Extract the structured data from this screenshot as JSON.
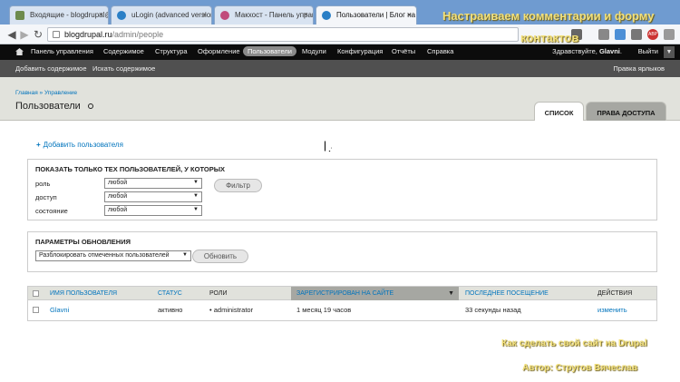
{
  "browser": {
    "tabs": [
      {
        "title": "Входящие - blogdrupal@",
        "color": "#6d8b4d"
      },
      {
        "title": "uLogin (advanced version",
        "color": "#2a7fc6"
      },
      {
        "title": "Макхост - Панель управ",
        "color": "#c04b7c"
      },
      {
        "title": "Пользователи | Блог на",
        "color": "#2a7fc6"
      }
    ],
    "tab_close": "×",
    "back_icon": "◀",
    "forward_icon": "▶",
    "reload_icon": "↻",
    "url_host": "blogdrupal.ru",
    "url_path": "/admin/people",
    "overlay_title_line1": "Настраиваем комментарии и форму",
    "overlay_title_line2": "контактов",
    "ext_label": "ABP"
  },
  "admin_toolbar": {
    "items": [
      "Панель управления",
      "Содержимое",
      "Структура",
      "Оформление",
      "Пользователи",
      "Модули",
      "Конфигурация",
      "Отчёты",
      "Справка"
    ],
    "active": "Пользователи",
    "greeting_prefix": "Здравствуйте,",
    "username": "Glavni",
    "greeting_suffix": ".",
    "logout": "Выйти",
    "toggle": "▼"
  },
  "shortcuts": {
    "items": [
      "Добавить содержимое",
      "Искать содержимое"
    ],
    "edit": "Правка ярлыков"
  },
  "page": {
    "breadcrumb": "Главная » Управление",
    "title": "Пользователи",
    "tabs": [
      "СПИСОК",
      "ПРАВА ДОСТУПА"
    ],
    "add_user": "Добавить пользователя",
    "add_icon": "+"
  },
  "filter": {
    "title": "Показать только тех пользователей, у которых",
    "fields": [
      {
        "label": "роль",
        "value": "любой"
      },
      {
        "label": "доступ",
        "value": "любой"
      },
      {
        "label": "состояние",
        "value": "любой"
      }
    ],
    "button": "Фильтр",
    "dropdown_arrow": "▼"
  },
  "update": {
    "title": "Параметры обновления",
    "selected": "Разблокировать отмеченных пользователей",
    "button": "Обновить"
  },
  "table": {
    "columns": [
      "Имя пользователя",
      "Статус",
      "Роли",
      "Зарегистрирован на сайте",
      "Последнее посещение",
      "Действия"
    ],
    "sort_icon": "▼",
    "rows": [
      {
        "name": "Glavni",
        "status": "активно",
        "role": "administrator",
        "registered": "1 месяц 19 часов",
        "last_access": "33 секунды назад",
        "action": "изменить"
      }
    ],
    "role_bullet": "•"
  },
  "overlay": {
    "line1": "Как сделать свой сайт на Drupal",
    "line2": "Автор: Стругов Вячеслав"
  }
}
